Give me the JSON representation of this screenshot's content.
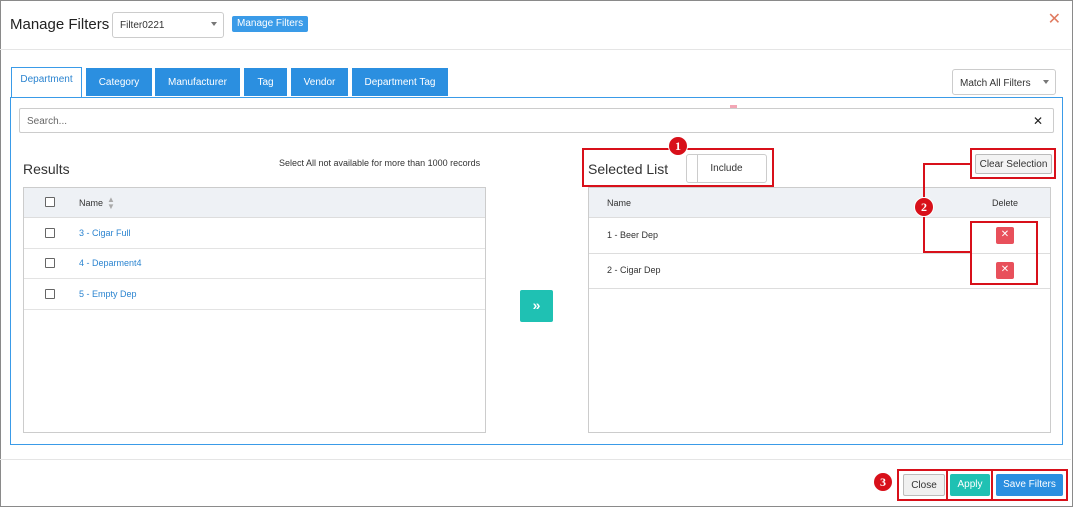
{
  "header": {
    "title": "Manage Filters",
    "filter_value": "Filter0221",
    "manage_btn": "Manage Filters"
  },
  "tabs": [
    {
      "label": "Department"
    },
    {
      "label": "Category"
    },
    {
      "label": "Manufacturer"
    },
    {
      "label": "Tag"
    },
    {
      "label": "Vendor"
    },
    {
      "label": "Department Tag"
    }
  ],
  "match_select": "Match All Filters",
  "search": {
    "placeholder": "Search..."
  },
  "results": {
    "title": "Results",
    "note": "Select All not available for more than 1000 records",
    "col_name": "Name",
    "rows": [
      "3 - Cigar Full",
      "4 - Deparment4",
      "5 - Empty Dep"
    ]
  },
  "selected": {
    "title": "Selected List",
    "include": "Include",
    "clear": "Clear Selection",
    "col_name": "Name",
    "col_delete": "Delete",
    "rows": [
      "1 - Beer Dep",
      "2 - Cigar Dep"
    ]
  },
  "footer": {
    "close": "Close",
    "apply": "Apply",
    "save": "Save Filters"
  },
  "annotations": {
    "b1": "1",
    "b2": "2",
    "b3": "3"
  },
  "colors": {
    "accent": "#2b8fe0",
    "teal": "#1fc1b3",
    "danger": "#e8505b",
    "annotation": "#d8101a"
  }
}
